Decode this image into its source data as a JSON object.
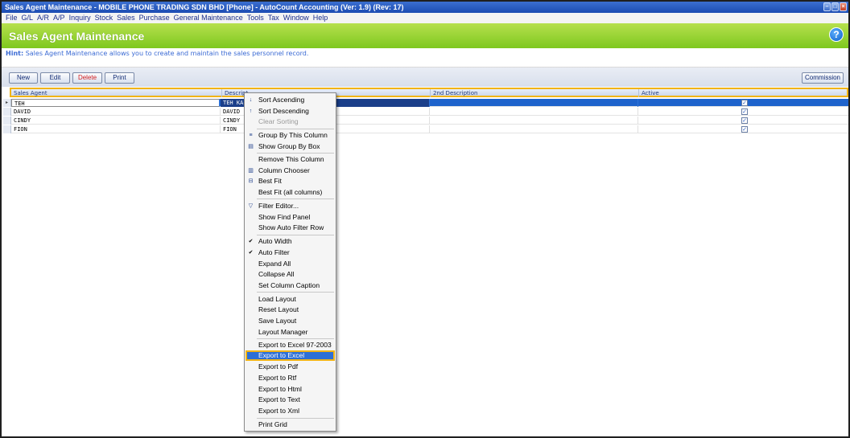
{
  "window": {
    "title": "Sales Agent Maintenance - MOBILE PHONE TRADING SDN BHD [Phone] - AutoCount Accounting (Ver: 1.9) (Rev: 17)"
  },
  "menu": [
    "File",
    "G/L",
    "A/R",
    "A/P",
    "Inquiry",
    "Stock",
    "Sales",
    "Purchase",
    "General Maintenance",
    "Tools",
    "Tax",
    "Window",
    "Help"
  ],
  "header": {
    "title": "Sales Agent Maintenance",
    "help": "?"
  },
  "hint": {
    "label": "Hint:",
    "text": "Sales Agent Maintenance allows you to create and maintain the sales personnel record."
  },
  "toolbar": {
    "new": "New",
    "edit": "Edit",
    "delete": "Delete",
    "print": "Print",
    "commission": "Commission"
  },
  "grid": {
    "columns": [
      "Sales Agent",
      "Descript",
      "2nd Description",
      "Active"
    ],
    "rows": [
      {
        "agent": "TEH",
        "desc": "TEH KA",
        "active": true
      },
      {
        "agent": "DAVID",
        "desc": "DAVID",
        "active": true
      },
      {
        "agent": "CINDY",
        "desc": "CINDY",
        "active": true
      },
      {
        "agent": "FION",
        "desc": "FION",
        "active": true
      }
    ]
  },
  "context_menu": {
    "items": [
      "Sort Ascending",
      "Sort Descending",
      "Clear Sorting",
      "Group By This Column",
      "Show Group By Box",
      "Remove This Column",
      "Column Chooser",
      "Best Fit",
      "Best Fit (all columns)",
      "Filter Editor...",
      "Show Find Panel",
      "Show Auto Filter Row",
      "Auto Width",
      "Auto Filter",
      "Expand All",
      "Collapse All",
      "Set Column Caption",
      "Load Layout",
      "Reset Layout",
      "Save Layout",
      "Layout Manager",
      "Export to Excel 97-2003",
      "Export to Excel",
      "Export to Pdf",
      "Export to Rtf",
      "Export to Html",
      "Export to Text",
      "Export to Xml",
      "Print Grid"
    ]
  }
}
